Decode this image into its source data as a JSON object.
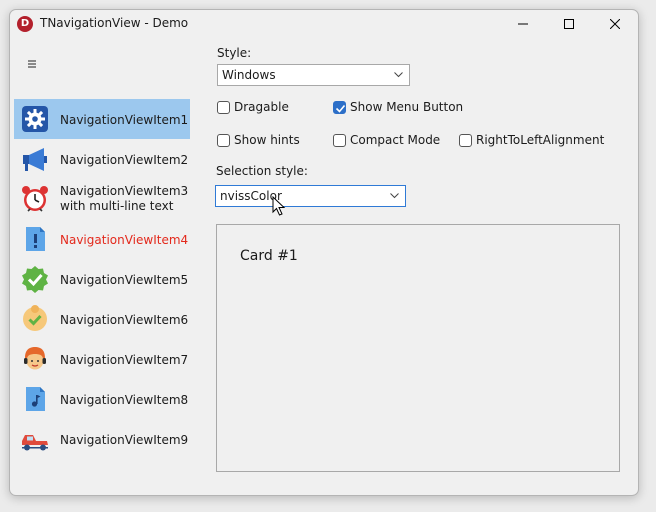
{
  "window": {
    "title": "TNavigationView - Demo",
    "app_icon_letter": "D"
  },
  "nav": {
    "items": [
      {
        "label": "NavigationViewItem1",
        "icon": "gear-icon",
        "selected": true
      },
      {
        "label": "NavigationViewItem2",
        "icon": "megaphone-icon"
      },
      {
        "label_line1": "NavigationViewItem3",
        "label_line2": "with multi-line text",
        "icon": "alarm-clock-icon"
      },
      {
        "label": "NavigationViewItem4",
        "icon": "document-alert-icon",
        "color": "#e3291c"
      },
      {
        "label": "NavigationViewItem5",
        "icon": "check-badge-icon"
      },
      {
        "label": "NavigationViewItem6",
        "icon": "face-check-icon"
      },
      {
        "label": "NavigationViewItem7",
        "icon": "support-agent-icon"
      },
      {
        "label": "NavigationViewItem8",
        "icon": "music-file-icon"
      },
      {
        "label": "NavigationViewItem9",
        "icon": "car-icon"
      }
    ]
  },
  "style": {
    "label": "Style:",
    "value": "Windows"
  },
  "options": {
    "dragable": {
      "label": "Dragable",
      "checked": false
    },
    "show_menu_button": {
      "label": "Show Menu Button",
      "checked": true
    },
    "show_hints": {
      "label": "Show hints",
      "checked": false
    },
    "compact_mode": {
      "label": "Compact Mode",
      "checked": false
    },
    "rtl": {
      "label": "RightToLeftAlignment",
      "checked": false
    }
  },
  "selection_style": {
    "label": "Selection style:",
    "value": "nvissColor"
  },
  "card": {
    "title": "Card #1"
  },
  "colors": {
    "selection": "#9cc8ee",
    "accent": "#2c6fc8",
    "alert_text": "#e3291c"
  }
}
